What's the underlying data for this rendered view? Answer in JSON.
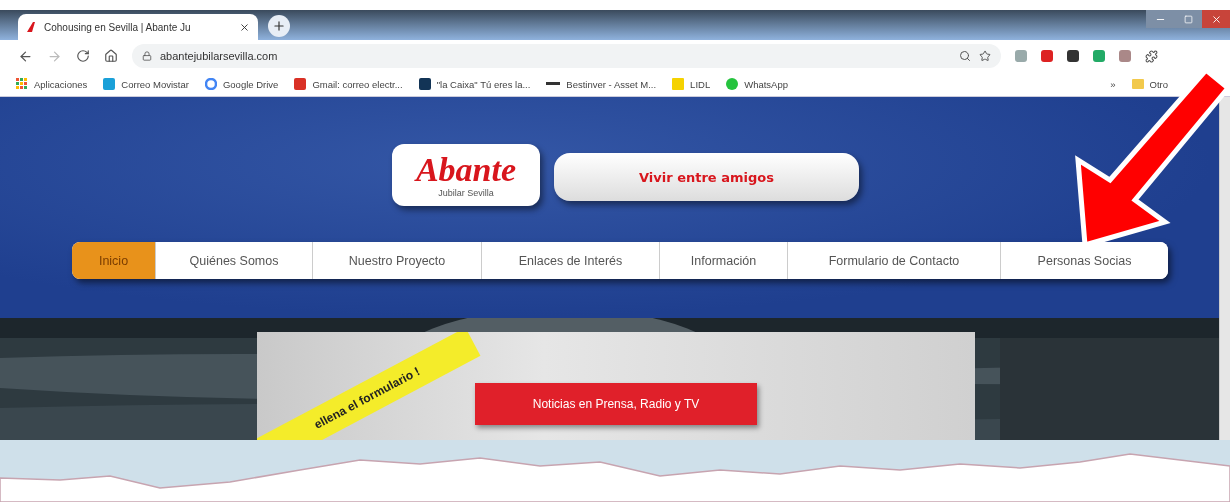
{
  "browser": {
    "tabs": [
      {
        "title": "Cohousing en Sevilla | Abante Ju",
        "selected": true
      }
    ],
    "url": "abantejubilarsevilla.com",
    "bookmarks": [
      {
        "label": "Aplicaciones",
        "kind": "apps"
      },
      {
        "label": "Correo Movistar",
        "kind": "movistar"
      },
      {
        "label": "Google Drive",
        "kind": "google"
      },
      {
        "label": "Gmail: correo electr...",
        "kind": "gmail"
      },
      {
        "label": "\"la Caixa\" Tú eres la...",
        "kind": "caixa"
      },
      {
        "label": "Bestinver - Asset M...",
        "kind": "line"
      },
      {
        "label": "LIDL",
        "kind": "lidl"
      },
      {
        "label": "WhatsApp",
        "kind": "whatsapp"
      }
    ],
    "more_bookmarks": "»",
    "other_bookmarks": "Otro"
  },
  "site": {
    "logo": "Abante",
    "logo_subtitle": "Jubilar Sevilla",
    "slogan": "Vivir entre amigos",
    "nav": [
      {
        "label": "Inicio",
        "selected": true
      },
      {
        "label": "Quiénes Somos",
        "selected": false
      },
      {
        "label": "Nuestro Proyecto",
        "selected": false
      },
      {
        "label": "Enlaces de Interés",
        "selected": false
      },
      {
        "label": "Información",
        "selected": false
      },
      {
        "label": "Formulario de Contacto",
        "selected": false
      },
      {
        "label": "Personas Socias",
        "selected": false
      }
    ],
    "banner": "ellena el formulario !",
    "news_button": "Noticias en Prensa, Radio y TV"
  }
}
